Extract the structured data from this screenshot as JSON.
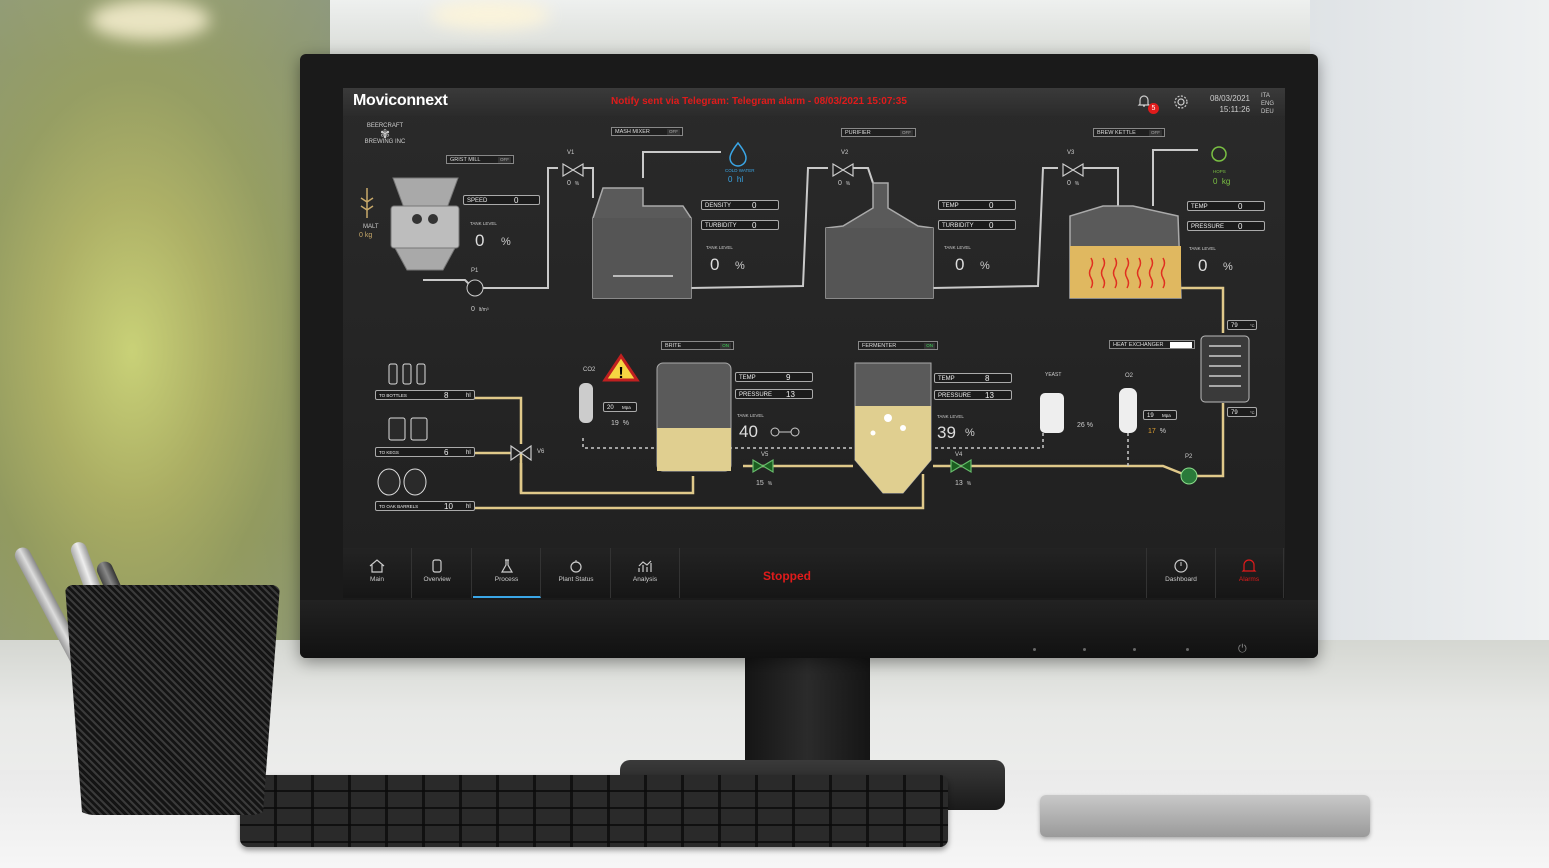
{
  "header": {
    "logo": "Moviconnext",
    "alarm_message": "Notify sent via Telegram: Telegram alarm - 08/03/2021 15:07:35",
    "notification_count": "5",
    "date": "08/03/2021",
    "time": "15:11:26",
    "languages": [
      "ITA",
      "ENG",
      "DEU"
    ]
  },
  "brand": {
    "line1": "BEERCRAFT",
    "line2": "BREWING INC"
  },
  "malt": {
    "label": "MALT",
    "value": "0",
    "unit": "kg"
  },
  "grist_mill": {
    "label": "GRIST MILL",
    "state": "OFF",
    "speed_label": "SPEED",
    "speed": "0",
    "tank_level_label": "TANK LEVEL",
    "tank_level": "0",
    "unit": "%"
  },
  "pump_p1": {
    "label": "P1",
    "value": "0",
    "unit": "lt/m³"
  },
  "valve_v1": {
    "label": "V1",
    "value": "0",
    "unit": "%"
  },
  "mash_mixer": {
    "label": "MASH MIXER",
    "state": "OFF",
    "density_label": "DENSITY",
    "density": "0",
    "turbidity_label": "TURBIDITY",
    "turbidity": "0",
    "tank_level_label": "TANK LEVEL",
    "tank_level": "0",
    "unit": "%"
  },
  "cold_water": {
    "label": "COLD WATER",
    "value": "0",
    "unit": "hl"
  },
  "valve_v2": {
    "label": "V2",
    "value": "0",
    "unit": "%"
  },
  "purifier": {
    "label": "PURIFIER",
    "state": "OFF",
    "temp_label": "TEMP",
    "temp": "0",
    "turbidity_label": "TURBIDITY",
    "turbidity": "0",
    "tank_level_label": "TANK LEVEL",
    "tank_level": "0",
    "unit": "%"
  },
  "valve_v3": {
    "label": "V3",
    "value": "0",
    "unit": "%"
  },
  "brew_kettle": {
    "label": "BREW KETTLE",
    "state": "OFF",
    "temp_label": "TEMP",
    "temp": "0",
    "pressure_label": "PRESSURE",
    "pressure": "0",
    "tank_level_label": "TANK LEVEL",
    "tank_level": "0",
    "unit": "%"
  },
  "hops": {
    "label": "HOPS",
    "value": "0",
    "unit": "kg"
  },
  "heat_exchanger": {
    "label": "HEAT EXCHANGER",
    "temp_top": "79",
    "temp_bottom": "79",
    "unit": "°C"
  },
  "outputs": {
    "bottles": {
      "label": "TO BOTTLES",
      "value": "8",
      "unit": "hl"
    },
    "kegs": {
      "label": "TO KEGS",
      "value": "6",
      "unit": "hl"
    },
    "oak": {
      "label": "TO OAK BARRELS",
      "value": "10",
      "unit": "hl"
    }
  },
  "valve_v6": {
    "label": "V6"
  },
  "co2": {
    "label": "CO2",
    "pressure": "20",
    "pressure_unit": "Mpa",
    "percent": "19",
    "unit": "%"
  },
  "brite": {
    "label": "BRITE",
    "state": "ON",
    "temp_label": "TEMP",
    "temp": "9",
    "pressure_label": "PRESSURE",
    "pressure": "13",
    "tank_level_label": "TANK LEVEL",
    "tank_level": "40"
  },
  "valve_v5": {
    "label": "V5",
    "value": "15",
    "unit": "%"
  },
  "fermenter": {
    "label": "FERMENTER",
    "state": "ON",
    "temp_label": "TEMP",
    "temp": "8",
    "pressure_label": "PRESSURE",
    "pressure": "13",
    "tank_level_label": "TANK LEVEL",
    "tank_level": "39",
    "unit": "%"
  },
  "valve_v4": {
    "label": "V4",
    "value": "13",
    "unit": "%"
  },
  "yeast": {
    "label": "YEAST",
    "value": "26",
    "unit": "%"
  },
  "o2": {
    "label": "O2",
    "pressure": "19",
    "pressure_unit": "Mpa",
    "percent": "17",
    "unit": "%"
  },
  "pump_p2": {
    "label": "P2"
  },
  "nav": {
    "main": "Main",
    "overview": "Overview",
    "process": "Process",
    "plant_status": "Plant Status",
    "analysis": "Analysis",
    "status": "Stopped",
    "dashboard": "Dashboard",
    "alarms": "Alarms"
  },
  "colors": {
    "alarm": "#e01b1b",
    "accent": "#3aa6e6",
    "pipe": "#e0c98a",
    "on": "#39d353"
  }
}
